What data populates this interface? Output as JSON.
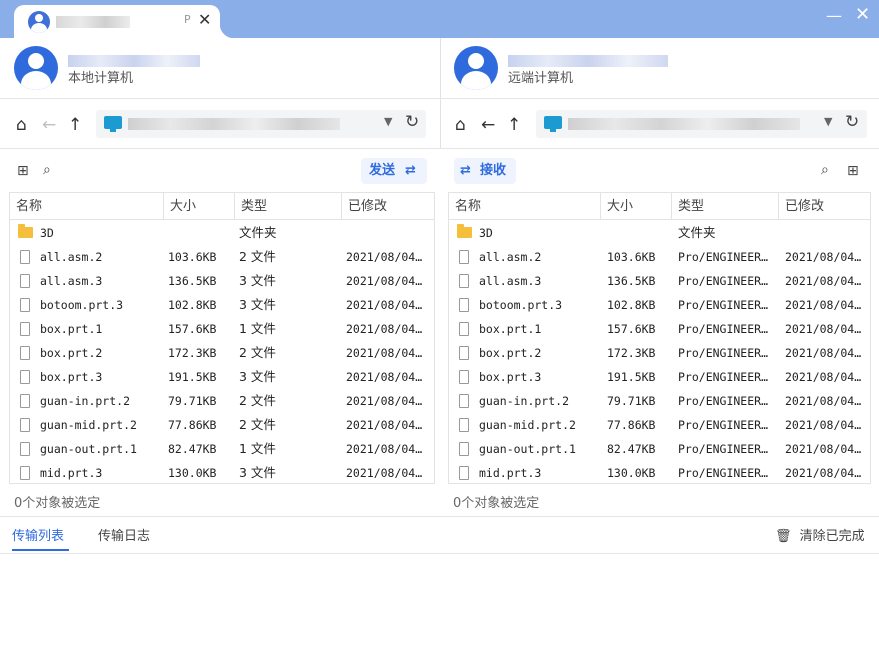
{
  "tab": {
    "p_label": "P",
    "close": "✕"
  },
  "window": {
    "minimize": "—",
    "close": "✕"
  },
  "local": {
    "caption": "本地计算机",
    "status": "0个对象被选定",
    "send_label": "发送",
    "send_icon": "⇄"
  },
  "remote": {
    "caption": "远端计算机",
    "status": "0个对象被选定",
    "receive_label": "接收",
    "receive_icon": "⇄"
  },
  "nav": {
    "home": "⌂",
    "back": "←",
    "up": "↑",
    "dropdown": "▼",
    "refresh": "↻",
    "new_folder": "⊞",
    "search": "⌕"
  },
  "columns": {
    "local": [
      "名称",
      "大小",
      "类型",
      "已修改"
    ],
    "remote": [
      "名称",
      "大小",
      "类型",
      "已修改"
    ]
  },
  "local_files": [
    {
      "name": "3D",
      "size": "",
      "type": "文件夹",
      "modified": "",
      "folder": true
    },
    {
      "name": "all.asm.2",
      "size": "103.6KB",
      "type": "2 文件",
      "modified": "2021/08/04…"
    },
    {
      "name": "all.asm.3",
      "size": "136.5KB",
      "type": "3 文件",
      "modified": "2021/08/04…"
    },
    {
      "name": "botoom.prt.3",
      "size": "102.8KB",
      "type": "3 文件",
      "modified": "2021/08/04…"
    },
    {
      "name": "box.prt.1",
      "size": "157.6KB",
      "type": "1 文件",
      "modified": "2021/08/04…"
    },
    {
      "name": "box.prt.2",
      "size": "172.3KB",
      "type": "2 文件",
      "modified": "2021/08/04…"
    },
    {
      "name": "box.prt.3",
      "size": "191.5KB",
      "type": "3 文件",
      "modified": "2021/08/04…"
    },
    {
      "name": "guan-in.prt.2",
      "size": "79.71KB",
      "type": "2 文件",
      "modified": "2021/08/04…"
    },
    {
      "name": "guan-mid.prt.2",
      "size": "77.86KB",
      "type": "2 文件",
      "modified": "2021/08/04…"
    },
    {
      "name": "guan-out.prt.1",
      "size": "82.47KB",
      "type": "1 文件",
      "modified": "2021/08/04…"
    },
    {
      "name": "mid.prt.3",
      "size": "130.0KB",
      "type": "3 文件",
      "modified": "2021/08/04…"
    }
  ],
  "remote_files": [
    {
      "name": "3D",
      "size": "",
      "type": "文件夹",
      "modified": "",
      "folder": true
    },
    {
      "name": "all.asm.2",
      "size": "103.6KB",
      "type": "Pro/ENGINEER…",
      "modified": "2021/08/04…"
    },
    {
      "name": "all.asm.3",
      "size": "136.5KB",
      "type": "Pro/ENGINEER…",
      "modified": "2021/08/04…"
    },
    {
      "name": "botoom.prt.3",
      "size": "102.8KB",
      "type": "Pro/ENGINEER…",
      "modified": "2021/08/04…"
    },
    {
      "name": "box.prt.1",
      "size": "157.6KB",
      "type": "Pro/ENGINEER…",
      "modified": "2021/08/04…"
    },
    {
      "name": "box.prt.2",
      "size": "172.3KB",
      "type": "Pro/ENGINEER…",
      "modified": "2021/08/04…"
    },
    {
      "name": "box.prt.3",
      "size": "191.5KB",
      "type": "Pro/ENGINEER…",
      "modified": "2021/08/04…"
    },
    {
      "name": "guan-in.prt.2",
      "size": "79.71KB",
      "type": "Pro/ENGINEER…",
      "modified": "2021/08/04…"
    },
    {
      "name": "guan-mid.prt.2",
      "size": "77.86KB",
      "type": "Pro/ENGINEER…",
      "modified": "2021/08/04…"
    },
    {
      "name": "guan-out.prt.1",
      "size": "82.47KB",
      "type": "Pro/ENGINEER…",
      "modified": "2021/08/04…"
    },
    {
      "name": "mid.prt.3",
      "size": "130.0KB",
      "type": "Pro/ENGINEER…",
      "modified": "2021/08/04…"
    }
  ],
  "bottom": {
    "tab_transfer_list": "传输列表",
    "tab_transfer_log": "传输日志",
    "clear_done": "清除已完成",
    "trash_icon": "🗑"
  },
  "colors": {
    "accent": "#2f6bdc",
    "titlebar": "#8aaee8",
    "folder": "#f6bf3b"
  }
}
